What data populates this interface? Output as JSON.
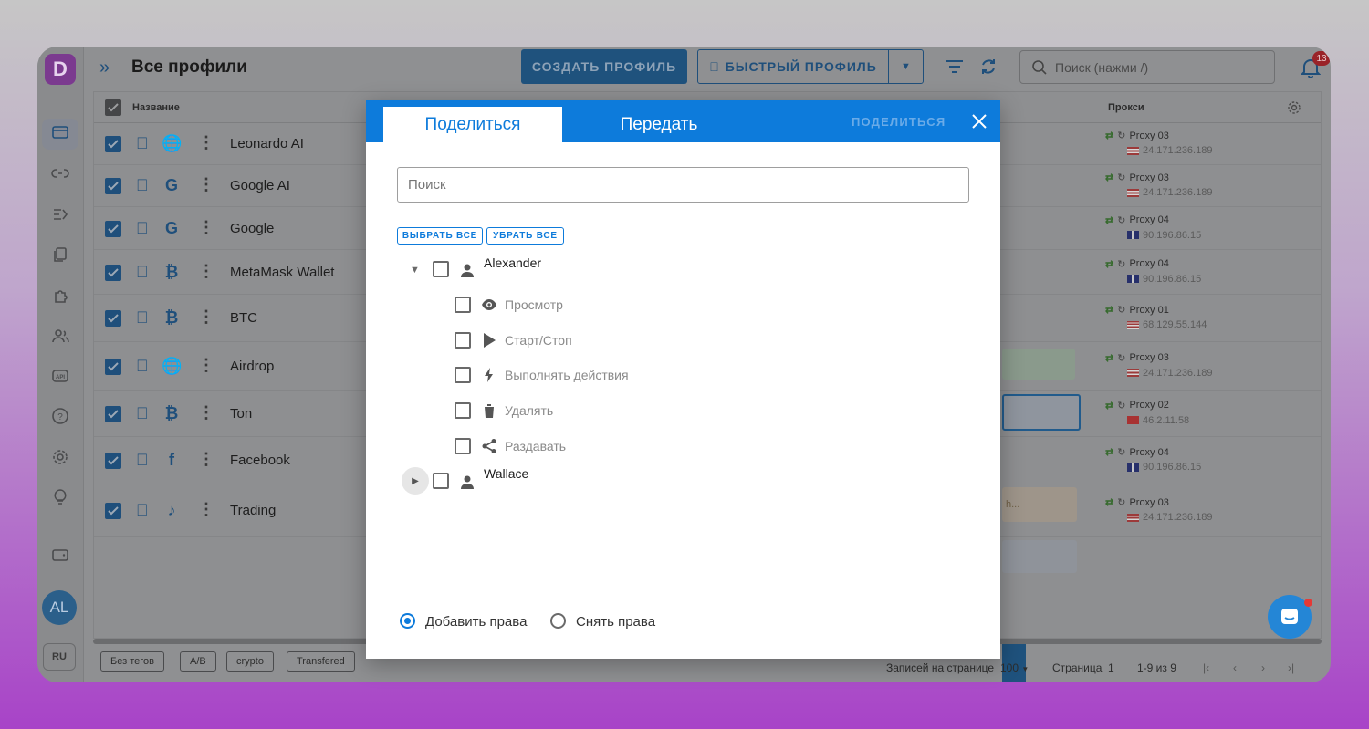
{
  "app": {
    "logo_letter": "D",
    "title": "Все профили",
    "create_profile": "СОЗДАТЬ ПРОФИЛЬ",
    "quick_profile": "БЫСТРЫЙ ПРОФИЛЬ",
    "search_placeholder": "Поиск (нажми /)",
    "notifications_count": "13",
    "avatar_initials": "AL",
    "language": "RU"
  },
  "table": {
    "col_name": "Название",
    "col_proxy": "Прокси",
    "rows": [
      {
        "name": "Leonardo AI",
        "service_icon": "globe-icon",
        "proxy": "Proxy 03",
        "ip": "24.171.236.189",
        "flag": "puerto-rico"
      },
      {
        "name": "Google AI",
        "service_icon": "google-icon",
        "proxy": "Proxy 03",
        "ip": "24.171.236.189",
        "flag": "puerto-rico"
      },
      {
        "name": "Google",
        "service_icon": "google-icon",
        "proxy": "Proxy 04",
        "ip": "90.196.86.15",
        "flag": "uk"
      },
      {
        "name": "MetaMask Wallet",
        "service_icon": "bitcoin-icon",
        "proxy": "Proxy 04",
        "ip": "90.196.86.15",
        "flag": "uk"
      },
      {
        "name": "BTC",
        "service_icon": "bitcoin-icon",
        "proxy": "Proxy 01",
        "ip": "68.129.55.144",
        "flag": "usa"
      },
      {
        "name": "Airdrop",
        "service_icon": "globe-icon",
        "proxy": "Proxy 03",
        "ip": "24.171.236.189",
        "flag": "puerto-rico"
      },
      {
        "name": "Ton",
        "service_icon": "bitcoin-icon",
        "proxy": "Proxy 02",
        "ip": "46.2.11.58",
        "flag": "turkey"
      },
      {
        "name": "Facebook",
        "service_icon": "facebook-icon",
        "proxy": "Proxy 04",
        "ip": "90.196.86.15",
        "flag": "uk"
      },
      {
        "name": "Trading",
        "service_icon": "tiktok-icon",
        "proxy": "Proxy 03",
        "ip": "24.171.236.189",
        "flag": "puerto-rico"
      }
    ],
    "ghost_text": "h..."
  },
  "tags": [
    "Без тегов",
    "A/B",
    "crypto",
    "Transfered"
  ],
  "pager": {
    "per_page_label": "Записей на странице",
    "per_page_value": "100",
    "page_label": "Страница",
    "page_value": "1",
    "range": "1-9 из 9"
  },
  "modal": {
    "tab_share": "Поделиться",
    "tab_transfer": "Передать",
    "action": "ПОДЕЛИТЬСЯ",
    "search_placeholder": "Поиск",
    "select_all": "ВЫБРАТЬ ВСЕ",
    "clear_all": "УБРАТЬ ВСЕ",
    "users": [
      {
        "name": "Alexander",
        "expanded": true
      },
      {
        "name": "Wallace",
        "expanded": false
      }
    ],
    "permissions": [
      {
        "label": "Просмотр",
        "icon": "eye-icon"
      },
      {
        "label": "Старт/Стоп",
        "icon": "play-icon"
      },
      {
        "label": "Выполнять действия",
        "icon": "bolt-icon"
      },
      {
        "label": "Удалять",
        "icon": "trash-icon"
      },
      {
        "label": "Раздавать",
        "icon": "share-icon"
      }
    ],
    "radio_add": "Добавить права",
    "radio_remove": "Снять права",
    "selected_radio": "add"
  },
  "colors": {
    "primary": "#0d7bdb",
    "overlay_primary": "#1f4f7b"
  }
}
